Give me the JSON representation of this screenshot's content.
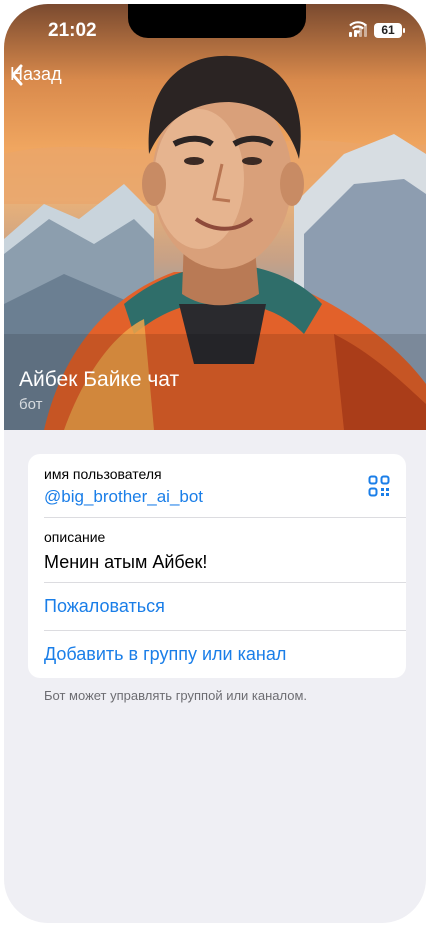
{
  "status_bar": {
    "time": "21:02",
    "battery": "61"
  },
  "nav": {
    "back_label": "Назад"
  },
  "profile": {
    "name": "Айбек Байке чат",
    "subtitle": "бот"
  },
  "info": {
    "username_label": "имя пользователя",
    "username": "@big_brother_ai_bot",
    "description_label": "описание",
    "description": "Менин атым Айбек!"
  },
  "actions": {
    "report": "Пожаловаться",
    "add_to_group": "Добавить в группу или канал"
  },
  "footnote": "Бот может управлять группой или каналом.",
  "colors": {
    "accent": "#1a7ee8",
    "background": "#efeff4",
    "card": "#ffffff"
  },
  "icons": {
    "back": "chevron-left-icon",
    "qr": "qr-code-icon",
    "wifi": "wifi-icon",
    "signal": "signal-icon"
  }
}
